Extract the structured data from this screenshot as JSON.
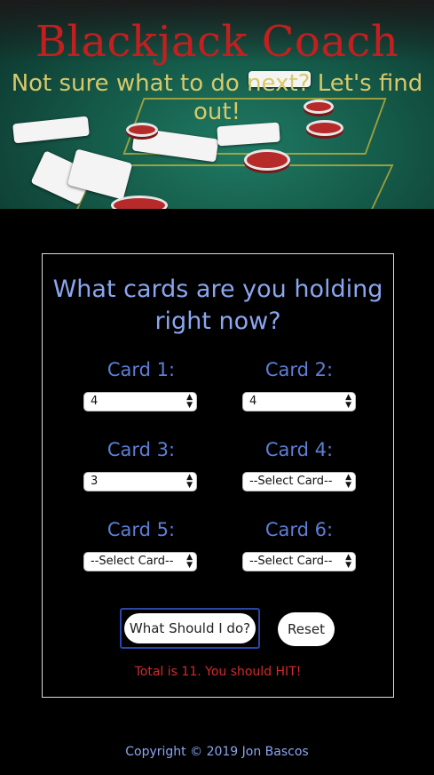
{
  "header": {
    "title": "Blackjack Coach",
    "subtitle": "Not sure what to do next? Let's find out!"
  },
  "form": {
    "question": "What cards are you holding right now?",
    "cards": [
      {
        "label": "Card 1:",
        "value": "4"
      },
      {
        "label": "Card 2:",
        "value": "4"
      },
      {
        "label": "Card 3:",
        "value": "3"
      },
      {
        "label": "Card 4:",
        "value": "--Select Card--"
      },
      {
        "label": "Card 5:",
        "value": "--Select Card--"
      },
      {
        "label": "Card 6:",
        "value": "--Select Card--"
      }
    ],
    "submit_label": "What Should I do?",
    "reset_label": "Reset",
    "result": "Total is 11. You should HIT!"
  },
  "footer": {
    "copyright": "Copyright © 2019 Jon Bascos"
  },
  "colors": {
    "title": "#c41f1f",
    "subtitle": "#d6c96a",
    "question": "#8aa6ee",
    "label": "#5c7fd6",
    "result": "#d42a2a"
  }
}
